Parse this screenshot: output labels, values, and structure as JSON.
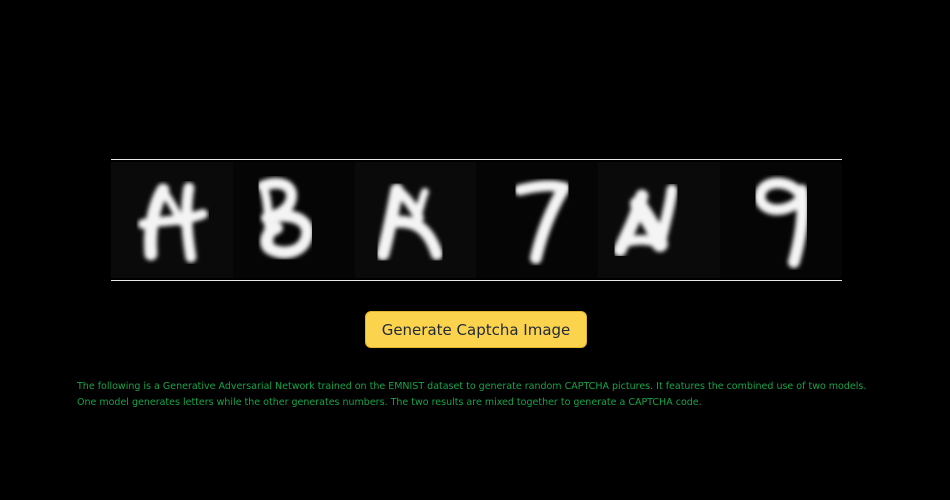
{
  "captcha": {
    "characters": [
      "H",
      "B",
      "K",
      "7",
      "N",
      "9"
    ]
  },
  "generate_button": {
    "label": "Generate Captcha Image"
  },
  "description": {
    "text": "The following is a Generative Adversarial Network trained on the EMNIST dataset to generate random CAPTCHA pictures. It features the combined use of two models. One model generates letters while the other generates numbers. The two results are mixed together to generate a CAPTCHA code."
  },
  "colors": {
    "background": "#000000",
    "button": "#fcd34d",
    "description_text": "#16a34a",
    "rule": "#e8e8e8"
  }
}
